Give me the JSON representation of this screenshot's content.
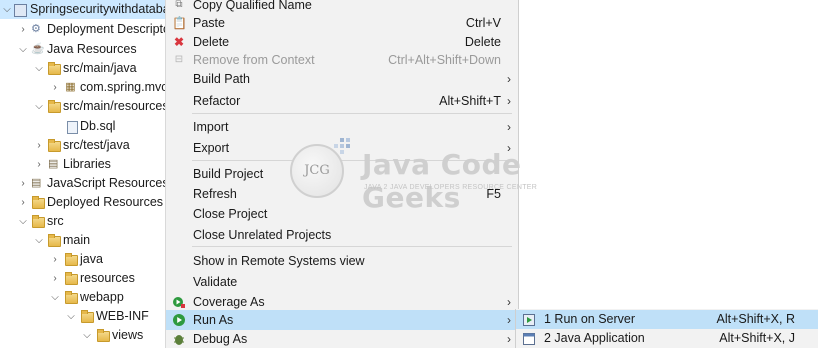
{
  "tree": {
    "items": [
      {
        "label": "Springsecuritywithdatabase",
        "icon": "project-icon",
        "expanded": true
      },
      {
        "label": "Deployment Descriptor",
        "icon": "deployment-descriptor-icon",
        "expanded": false
      },
      {
        "label": "Java Resources",
        "icon": "java-resources-icon",
        "expanded": true
      },
      {
        "label": "src/main/java",
        "icon": "source-folder-icon",
        "expanded": true
      },
      {
        "label": "com.spring.mvc",
        "icon": "package-icon",
        "expanded": false
      },
      {
        "label": "src/main/resources",
        "icon": "source-folder-icon",
        "expanded": true
      },
      {
        "label": "Db.sql",
        "icon": "file-icon",
        "expanded": null
      },
      {
        "label": "src/test/java",
        "icon": "source-folder-icon",
        "expanded": false
      },
      {
        "label": "Libraries",
        "icon": "library-icon",
        "expanded": false
      },
      {
        "label": "JavaScript Resources",
        "icon": "javascript-resources-icon",
        "expanded": false
      },
      {
        "label": "Deployed Resources",
        "icon": "deployed-resources-icon",
        "expanded": false
      },
      {
        "label": "src",
        "icon": "folder-icon",
        "expanded": true
      },
      {
        "label": "main",
        "icon": "folder-icon",
        "expanded": true
      },
      {
        "label": "java",
        "icon": "folder-icon",
        "expanded": false
      },
      {
        "label": "resources",
        "icon": "folder-icon",
        "expanded": false
      },
      {
        "label": "webapp",
        "icon": "folder-icon",
        "expanded": true
      },
      {
        "label": "WEB-INF",
        "icon": "folder-icon",
        "expanded": true
      },
      {
        "label": "views",
        "icon": "folder-icon",
        "expanded": true
      }
    ]
  },
  "menu": {
    "items": [
      {
        "label": "Copy Qualified Name",
        "shortcut": "",
        "icon": "copy-qualified-name-icon",
        "disabled": false,
        "submenu": false
      },
      {
        "label": "Paste",
        "shortcut": "Ctrl+V",
        "icon": "paste-icon",
        "disabled": false,
        "submenu": false
      },
      {
        "label": "Delete",
        "shortcut": "Delete",
        "icon": "delete-icon",
        "disabled": false,
        "submenu": false
      },
      {
        "label": "Remove from Context",
        "shortcut": "Ctrl+Alt+Shift+Down",
        "icon": "remove-from-context-icon",
        "disabled": true,
        "submenu": false
      },
      {
        "label": "Build Path",
        "shortcut": "",
        "icon": "",
        "disabled": false,
        "submenu": true
      },
      {
        "label": "Refactor",
        "shortcut": "Alt+Shift+T",
        "icon": "",
        "disabled": false,
        "submenu": true
      },
      {
        "label": "Import",
        "shortcut": "",
        "icon": "",
        "disabled": false,
        "submenu": true
      },
      {
        "label": "Export",
        "shortcut": "",
        "icon": "",
        "disabled": false,
        "submenu": true
      },
      {
        "label": "Build Project",
        "shortcut": "",
        "icon": "",
        "disabled": false,
        "submenu": false
      },
      {
        "label": "Refresh",
        "shortcut": "F5",
        "icon": "",
        "disabled": false,
        "submenu": false
      },
      {
        "label": "Close Project",
        "shortcut": "",
        "icon": "",
        "disabled": false,
        "submenu": false
      },
      {
        "label": "Close Unrelated Projects",
        "shortcut": "",
        "icon": "",
        "disabled": false,
        "submenu": false
      },
      {
        "label": "Show in Remote Systems view",
        "shortcut": "",
        "icon": "",
        "disabled": false,
        "submenu": false
      },
      {
        "label": "Validate",
        "shortcut": "",
        "icon": "",
        "disabled": false,
        "submenu": false
      },
      {
        "label": "Coverage As",
        "shortcut": "",
        "icon": "coverage-icon",
        "disabled": false,
        "submenu": true
      },
      {
        "label": "Run As",
        "shortcut": "",
        "icon": "run-icon",
        "disabled": false,
        "submenu": true,
        "highlighted": true
      },
      {
        "label": "Debug As",
        "shortcut": "",
        "icon": "debug-icon",
        "disabled": false,
        "submenu": true
      }
    ]
  },
  "submenu": {
    "items": [
      {
        "label": "1 Run on Server",
        "shortcut": "Alt+Shift+X, R",
        "icon": "run-on-server-icon"
      },
      {
        "label": "2 Java Application",
        "shortcut": "Alt+Shift+X, J",
        "icon": "java-application-icon"
      }
    ]
  },
  "watermark": {
    "logo_text": "JCG",
    "title": "Java Code Geeks",
    "subtitle": "JAVA 2 JAVA DEVELOPERS RESOURCE CENTER"
  },
  "colors": {
    "selection": "#cce8ff",
    "menu_background": "#f2f2f2",
    "menu_highlight": "#bfe0f8",
    "run_icon": "#2e9a3f",
    "delete_icon": "#d9363e"
  }
}
